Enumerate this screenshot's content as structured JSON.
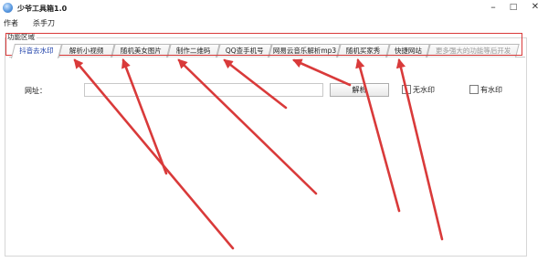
{
  "window": {
    "title": "少爷工具箱1.0",
    "controls": {
      "minimize": "–",
      "maximize": "□",
      "close": "✕"
    }
  },
  "menu": [
    {
      "label": "作者"
    },
    {
      "label": "杀手刀"
    }
  ],
  "group": {
    "legend": "功能区域"
  },
  "tabs": [
    {
      "label": "抖音去水印",
      "state": "active"
    },
    {
      "label": "解析小视频",
      "state": "normal"
    },
    {
      "label": "随机美女图片",
      "state": "normal"
    },
    {
      "label": "制作二维码",
      "state": "normal"
    },
    {
      "label": "QQ查手机号",
      "state": "normal"
    },
    {
      "label": "网易云音乐解析mp3",
      "state": "normal"
    },
    {
      "label": "随机买家秀",
      "state": "normal"
    },
    {
      "label": "快捷网站",
      "state": "normal"
    },
    {
      "label": "更多强大的功能等后开发",
      "state": "disabled"
    }
  ],
  "form": {
    "url_label": "网址：",
    "url_value": "",
    "parse_button": "解析",
    "checkbox_no_watermark": {
      "label": "无水印",
      "checked": false
    },
    "checkbox_watermark": {
      "label": "有水印",
      "checked": false
    }
  },
  "annotation": {
    "color": "#d93a3a"
  }
}
